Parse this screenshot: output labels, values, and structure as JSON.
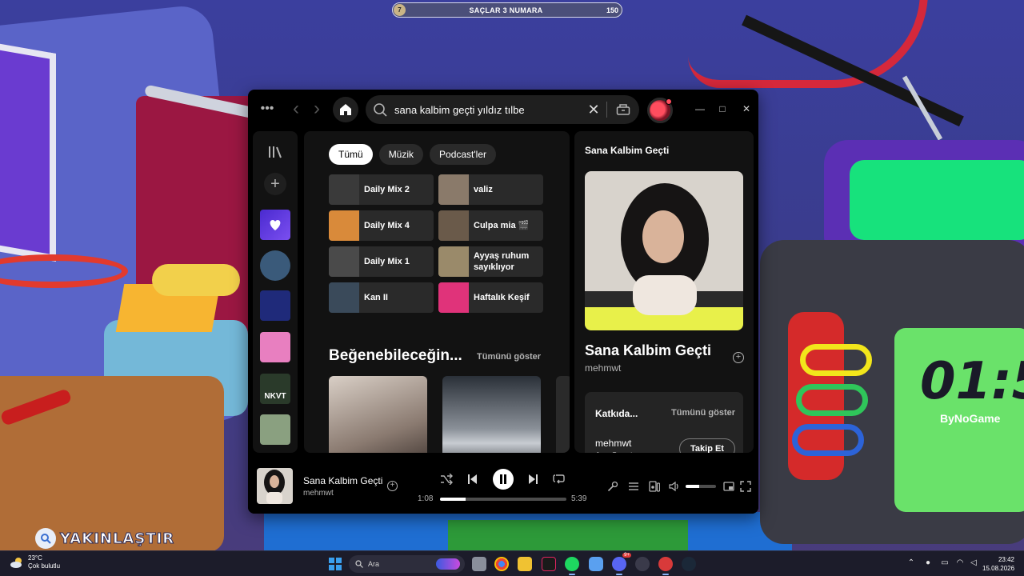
{
  "game": {
    "hud_level": "7",
    "hud_title": "SAÇLAR 3 NUMARA",
    "hud_coins": "150",
    "zoom_label": "YAKINLAŞTIR",
    "clock_digits": "01:5",
    "clock_brand": "ByNoGame"
  },
  "spotify": {
    "topbar": {
      "menu_glyph": "•••",
      "back_glyph": "‹",
      "forward_glyph": "›",
      "search_value": "sana kalbim geçti yıldız tılbe",
      "clear_glyph": "✕",
      "min_glyph": "—",
      "max_glyph": "□",
      "close_glyph": "✕"
    },
    "rail": {
      "plus_glyph": "+",
      "items": [
        {
          "name": "liked-songs",
          "color": "#7b4ff0"
        },
        {
          "name": "playlist-1",
          "color": "#3a5a7a"
        },
        {
          "name": "playlist-2",
          "color": "#1f2a7a"
        },
        {
          "name": "playlist-3",
          "color": "#e87fc0"
        },
        {
          "name": "playlist-4",
          "color": "#2a3a2a",
          "text": "NKVT"
        },
        {
          "name": "playlist-5",
          "color": "#8aa080"
        }
      ]
    },
    "main": {
      "chips": [
        "Tümü",
        "Müzik",
        "Podcast'ler"
      ],
      "active_chip": "Tümü",
      "shortcuts": [
        {
          "label": "Daily Mix 2",
          "color": "#3a3a3a",
          "tag": "02"
        },
        {
          "label": "valiz",
          "color": "#8a7a6a"
        },
        {
          "label": "Daily Mix 4",
          "color": "#d98a3a",
          "tag": "04"
        },
        {
          "label": "Culpa mia 🎬",
          "color": "#6a5a4a"
        },
        {
          "label": "Daily Mix 1",
          "color": "#4a4a4a",
          "tag": "01"
        },
        {
          "label": "Ayyaş ruhum sayıklıyor",
          "color": "#9a8a6a"
        },
        {
          "label": "Kan II",
          "color": "#3a4a5a"
        },
        {
          "label": "Haftalık Keşif",
          "color": "#e0337a"
        }
      ],
      "section_title": "Beğenebileceğin...",
      "section_link": "Tümünü göster"
    },
    "now_playing_panel": {
      "header": "Sana Kalbim Geçti",
      "title": "Sana Kalbim Geçti",
      "artist": "mehmwt",
      "add_glyph": "+",
      "credits": {
        "title": "Katkıda...",
        "link": "Tümünü göster",
        "name": "mehmwt",
        "role": "Ana Sanatçı",
        "follow": "Takip Et"
      }
    },
    "player": {
      "title": "Sana Kalbim Geçti",
      "artist": "mehmwt",
      "add_glyph": "+",
      "elapsed": "1:08",
      "duration": "5:39",
      "progress_fraction": 0.2,
      "volume_fraction": 0.45
    }
  },
  "taskbar": {
    "temperature": "23°C",
    "condition": "Çok bulutlu",
    "search_placeholder": "Ara",
    "discord_badge": "9+",
    "time": "23:42",
    "date": "15.08.2026"
  }
}
